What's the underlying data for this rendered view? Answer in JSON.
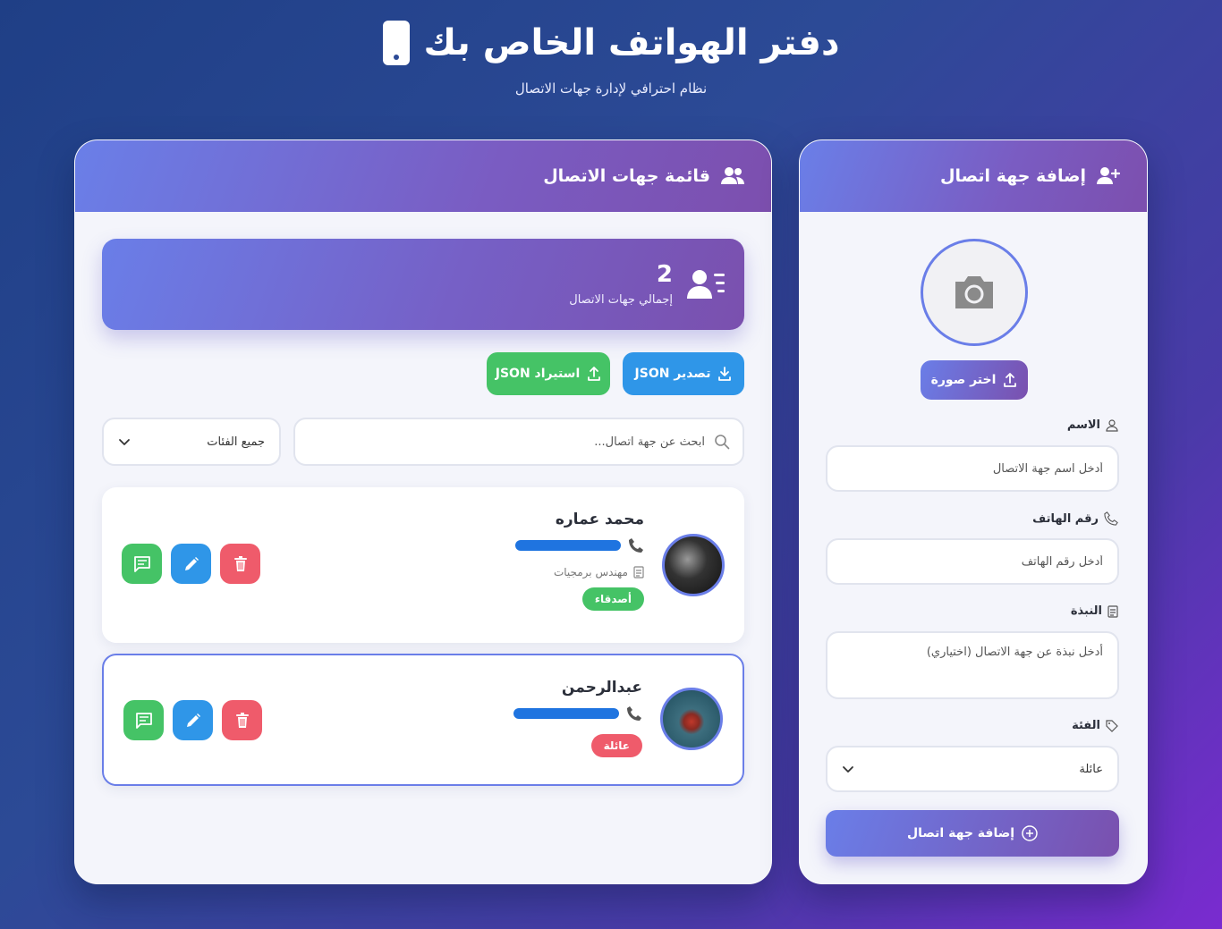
{
  "app": {
    "title": "دفتر الهواتف الخاص بك",
    "subtitle": "نظام احترافي لإدارة جهات الاتصال"
  },
  "list_panel": {
    "title": "قائمة جهات الاتصال",
    "stats": {
      "count": "2",
      "label": "إجمالي جهات الاتصال"
    },
    "export_label": "تصدير JSON",
    "import_label": "استيراد JSON",
    "search_placeholder": "ابحث عن جهة اتصال...",
    "filter": {
      "selected": "جميع الفئات"
    },
    "contacts": [
      {
        "name": "محمد عماره",
        "note": "مهندس برمجيات",
        "category": "أصدقاء",
        "category_color": "#45c366"
      },
      {
        "name": "عبدالرحمن",
        "category": "عائلة",
        "category_color": "#ef5b6b"
      }
    ]
  },
  "form_panel": {
    "title": "إضافة جهة اتصال",
    "choose_photo_label": "اختر صورة",
    "name_label": "الاسم",
    "name_placeholder": "أدخل اسم جهة الاتصال",
    "phone_label": "رقم الهاتف",
    "phone_placeholder": "أدخل رقم الهاتف",
    "bio_label": "النبذة",
    "bio_placeholder": "أدخل نبذة عن جهة الاتصال (اختياري)",
    "category_label": "الفئة",
    "category_selected": "عائلة",
    "submit_label": "إضافة جهة اتصال"
  },
  "colors": {
    "accent": "#6a7ee8",
    "export": "#2f96e8",
    "import": "#45c366",
    "delete": "#ef5b6b"
  }
}
